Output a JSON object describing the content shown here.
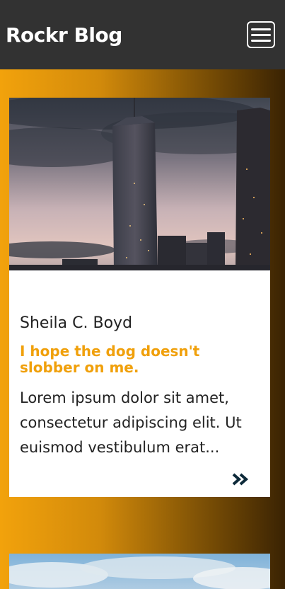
{
  "header": {
    "brand": "Rockr Blog",
    "menu_icon": "hamburger-menu-icon"
  },
  "posts": [
    {
      "author": "Sheila C. Boyd",
      "title": "I hope the dog doesn't slobber on me.",
      "excerpt": "Lorem ipsum dolor sit amet, consectetur adipiscing elit. Ut euismod vestibulum erat...",
      "image": "city-skyline-photo",
      "read_more_icon": "double-chevron-right-icon"
    },
    {
      "image": "sky-photo"
    }
  ],
  "colors": {
    "header_bg": "#323232",
    "accent": "#f0a00b",
    "icon": "#0d2a3a"
  }
}
